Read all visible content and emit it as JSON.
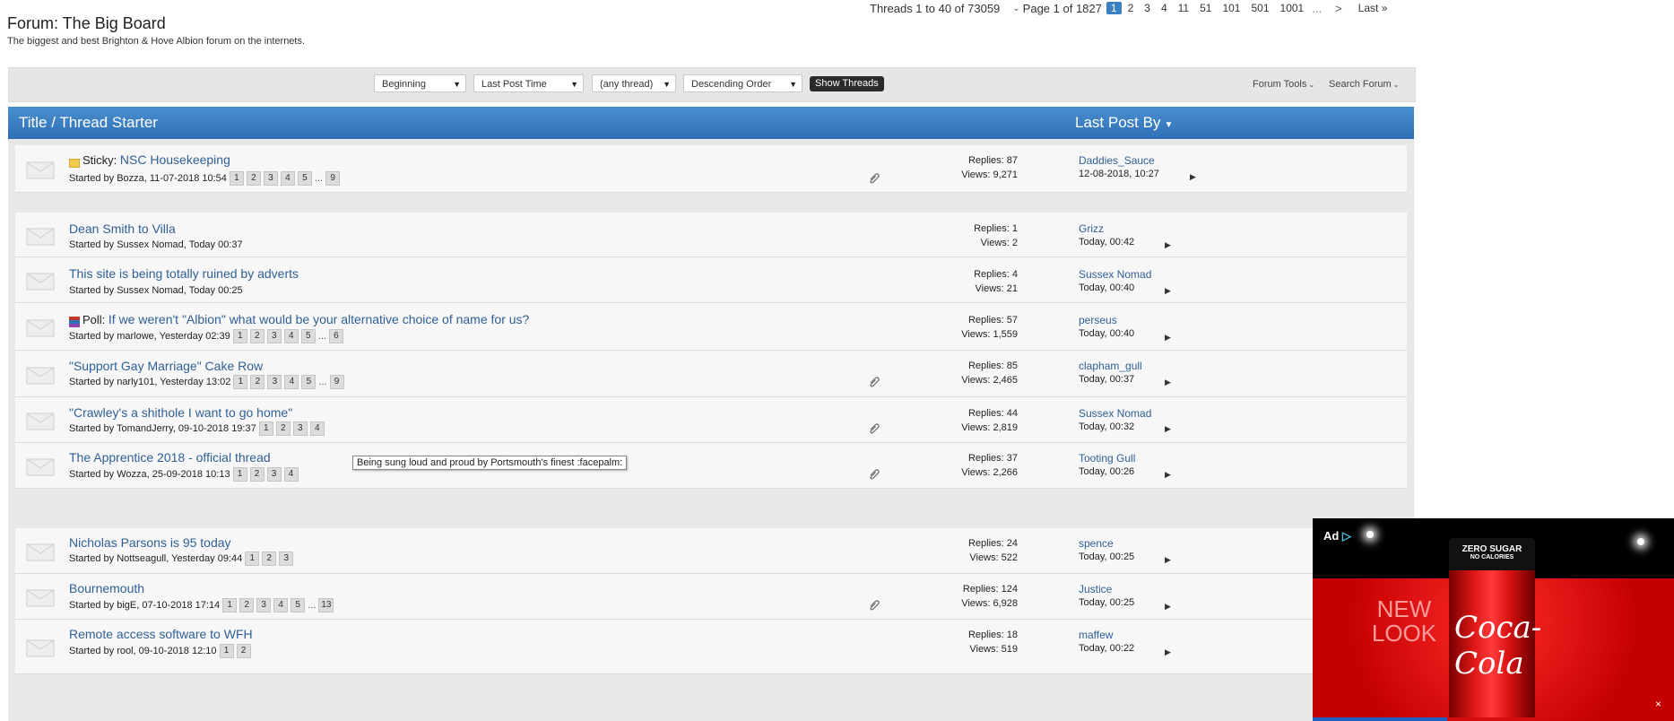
{
  "forum": {
    "title": "Forum: The Big Board",
    "description": "The biggest and best Brighton & Hove Albion forum on the internets."
  },
  "pagination": {
    "threads_count": "Threads 1 to 40 of 73059",
    "page_label": "Page 1 of 1827",
    "pages": [
      "1",
      "2",
      "3",
      "4",
      "11",
      "51",
      "101",
      "501",
      "1001"
    ],
    "current": "1",
    "ellipsis": "...",
    "next": ">",
    "last": "Last"
  },
  "filters": {
    "from": "Beginning",
    "sort": "Last Post Time",
    "prefix": "(any thread)",
    "order": "Descending Order",
    "show_button": "Show Threads",
    "forum_tools": "Forum Tools",
    "search_forum": "Search Forum"
  },
  "table_header": {
    "title_col": "Title / Thread Starter",
    "lastpost_col": "Last Post By"
  },
  "threads": [
    {
      "prefix": "Sticky:",
      "title": "NSC Housekeeping",
      "starter": "Started by Bozza, 11-07-2018 10:54",
      "pages": [
        "1",
        "2",
        "3",
        "4",
        "5"
      ],
      "last_page": "9",
      "replies": "Replies: 87",
      "views": "Views: 9,271",
      "lp_user": "Daddies_Sauce",
      "lp_time": "12-08-2018, 10:27"
    },
    {
      "title": "Dean Smith to Villa",
      "starter": "Started by Sussex Nomad, Today 00:37",
      "replies": "Replies: 1",
      "views": "Views: 2",
      "lp_user": "Grizz",
      "lp_time": "Today, 00:42"
    },
    {
      "title": "This site is being totally ruined by adverts",
      "starter": "Started by Sussex Nomad, Today 00:25",
      "replies": "Replies: 4",
      "views": "Views: 21",
      "lp_user": "Sussex Nomad",
      "lp_time": "Today, 00:40"
    },
    {
      "prefix": "Poll:",
      "title": "If we weren't \"Albion\" what would be your alternative choice of name for us?",
      "starter": "Started by marlowe, Yesterday 02:39",
      "pages": [
        "1",
        "2",
        "3",
        "4",
        "5"
      ],
      "last_page": "6",
      "replies": "Replies: 57",
      "views": "Views: 1,559",
      "lp_user": "perseus",
      "lp_time": "Today, 00:40"
    },
    {
      "title": "\"Support Gay Marriage\" Cake Row",
      "starter": "Started by narly101, Yesterday 13:02",
      "pages": [
        "1",
        "2",
        "3",
        "4",
        "5"
      ],
      "last_page": "9",
      "replies": "Replies: 85",
      "views": "Views: 2,465",
      "lp_user": "clapham_gull",
      "lp_time": "Today, 00:37"
    },
    {
      "title": "\"Crawley's a shithole I want to go home\"",
      "starter": "Started by TomandJerry, 09-10-2018 19:37",
      "pages": [
        "1",
        "2",
        "3",
        "4"
      ],
      "replies": "Replies: 44",
      "views": "Views: 2,819",
      "lp_user": "Sussex Nomad",
      "lp_time": "Today, 00:32"
    },
    {
      "title": "The Apprentice 2018 - official thread",
      "starter": "Started by Wozza, 25-09-2018 10:13",
      "pages": [
        "1",
        "2",
        "3",
        "4"
      ],
      "replies": "Replies: 37",
      "views": "Views: 2,266",
      "lp_user": "Tooting Gull",
      "lp_time": "Today, 00:26"
    },
    {
      "title": "Nicholas Parsons is 95 today",
      "starter": "Started by Nottseagull, Yesterday 09:44",
      "pages": [
        "1",
        "2",
        "3"
      ],
      "replies": "Replies: 24",
      "views": "Views: 522",
      "lp_user": "spence",
      "lp_time": "Today, 00:25"
    },
    {
      "title": "Bournemouth",
      "starter": "Started by bigE, 07-10-2018 17:14",
      "pages": [
        "1",
        "2",
        "3",
        "4",
        "5"
      ],
      "last_page": "13",
      "replies": "Replies: 124",
      "views": "Views: 6,928",
      "lp_user": "Justice",
      "lp_time": "Today, 00:25"
    },
    {
      "title": "Remote access software to WFH",
      "starter": "Started by rool, 09-10-2018 12:10",
      "pages": [
        "1",
        "2"
      ],
      "replies": "Replies: 18",
      "views": "Views: 519",
      "lp_user": "maffew",
      "lp_time": "Today, 00:22"
    }
  ],
  "tooltip": "Being sung loud and proud by Portsmouth's finest :facepalm:",
  "ad": {
    "badge": "Ad",
    "headline": "NEW LOOK",
    "can_top": "ZERO SUGAR",
    "can_sub": "NO CALORIES",
    "brand": "Coca-Cola",
    "close": "×"
  }
}
